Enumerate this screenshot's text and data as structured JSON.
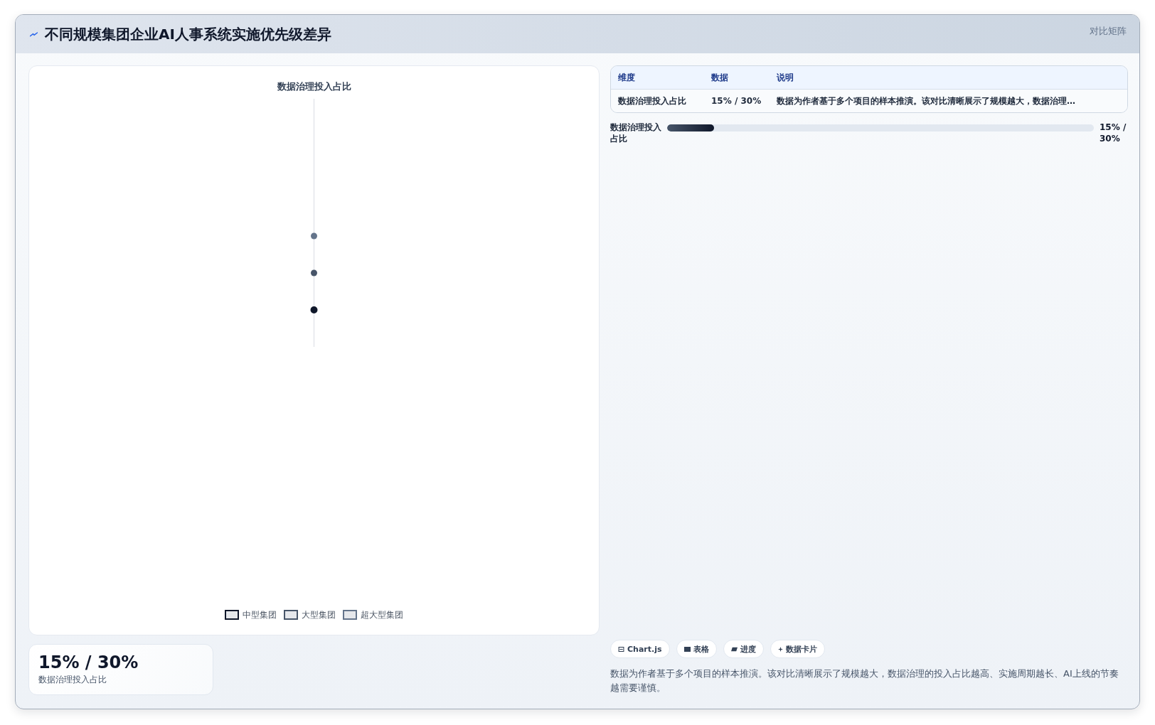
{
  "header": {
    "title": "不同规模集团企业AI人事系统实施优先级差异",
    "tag": "对比矩阵"
  },
  "chart": {
    "title": "数据治理投入占比",
    "legend": [
      {
        "label": "中型集团",
        "color": "#0f172a"
      },
      {
        "label": "大型集团",
        "color": "#475569"
      },
      {
        "label": "超大型集团",
        "color": "#64748b"
      }
    ]
  },
  "stat_card": {
    "value": "15% / 30%",
    "label": "数据治理投入占比"
  },
  "table": {
    "columns": [
      "维度",
      "数据",
      "说明"
    ],
    "rows": [
      [
        "数据治理投入占比",
        "15% / 30%",
        "数据为作者基于多个项目的样本推演。该对比清晰展示了规模越大，数据治理…"
      ]
    ]
  },
  "progress": [
    {
      "label": "数据治理投入占比",
      "level": 0.11,
      "reading": "15% / 30%"
    }
  ],
  "chips": [
    {
      "kind": "chart",
      "label": "Chart.js"
    },
    {
      "kind": "table",
      "label": "表格"
    },
    {
      "kind": "progress",
      "label": "进度"
    },
    {
      "kind": "card",
      "label": "数据卡片"
    }
  ],
  "note": "数据为作者基于多个项目的样本推演。该对比清晰展示了规模越大，数据治理的投入占比越高、实施周期越长、AI上线的节奏越需要谨慎。"
}
